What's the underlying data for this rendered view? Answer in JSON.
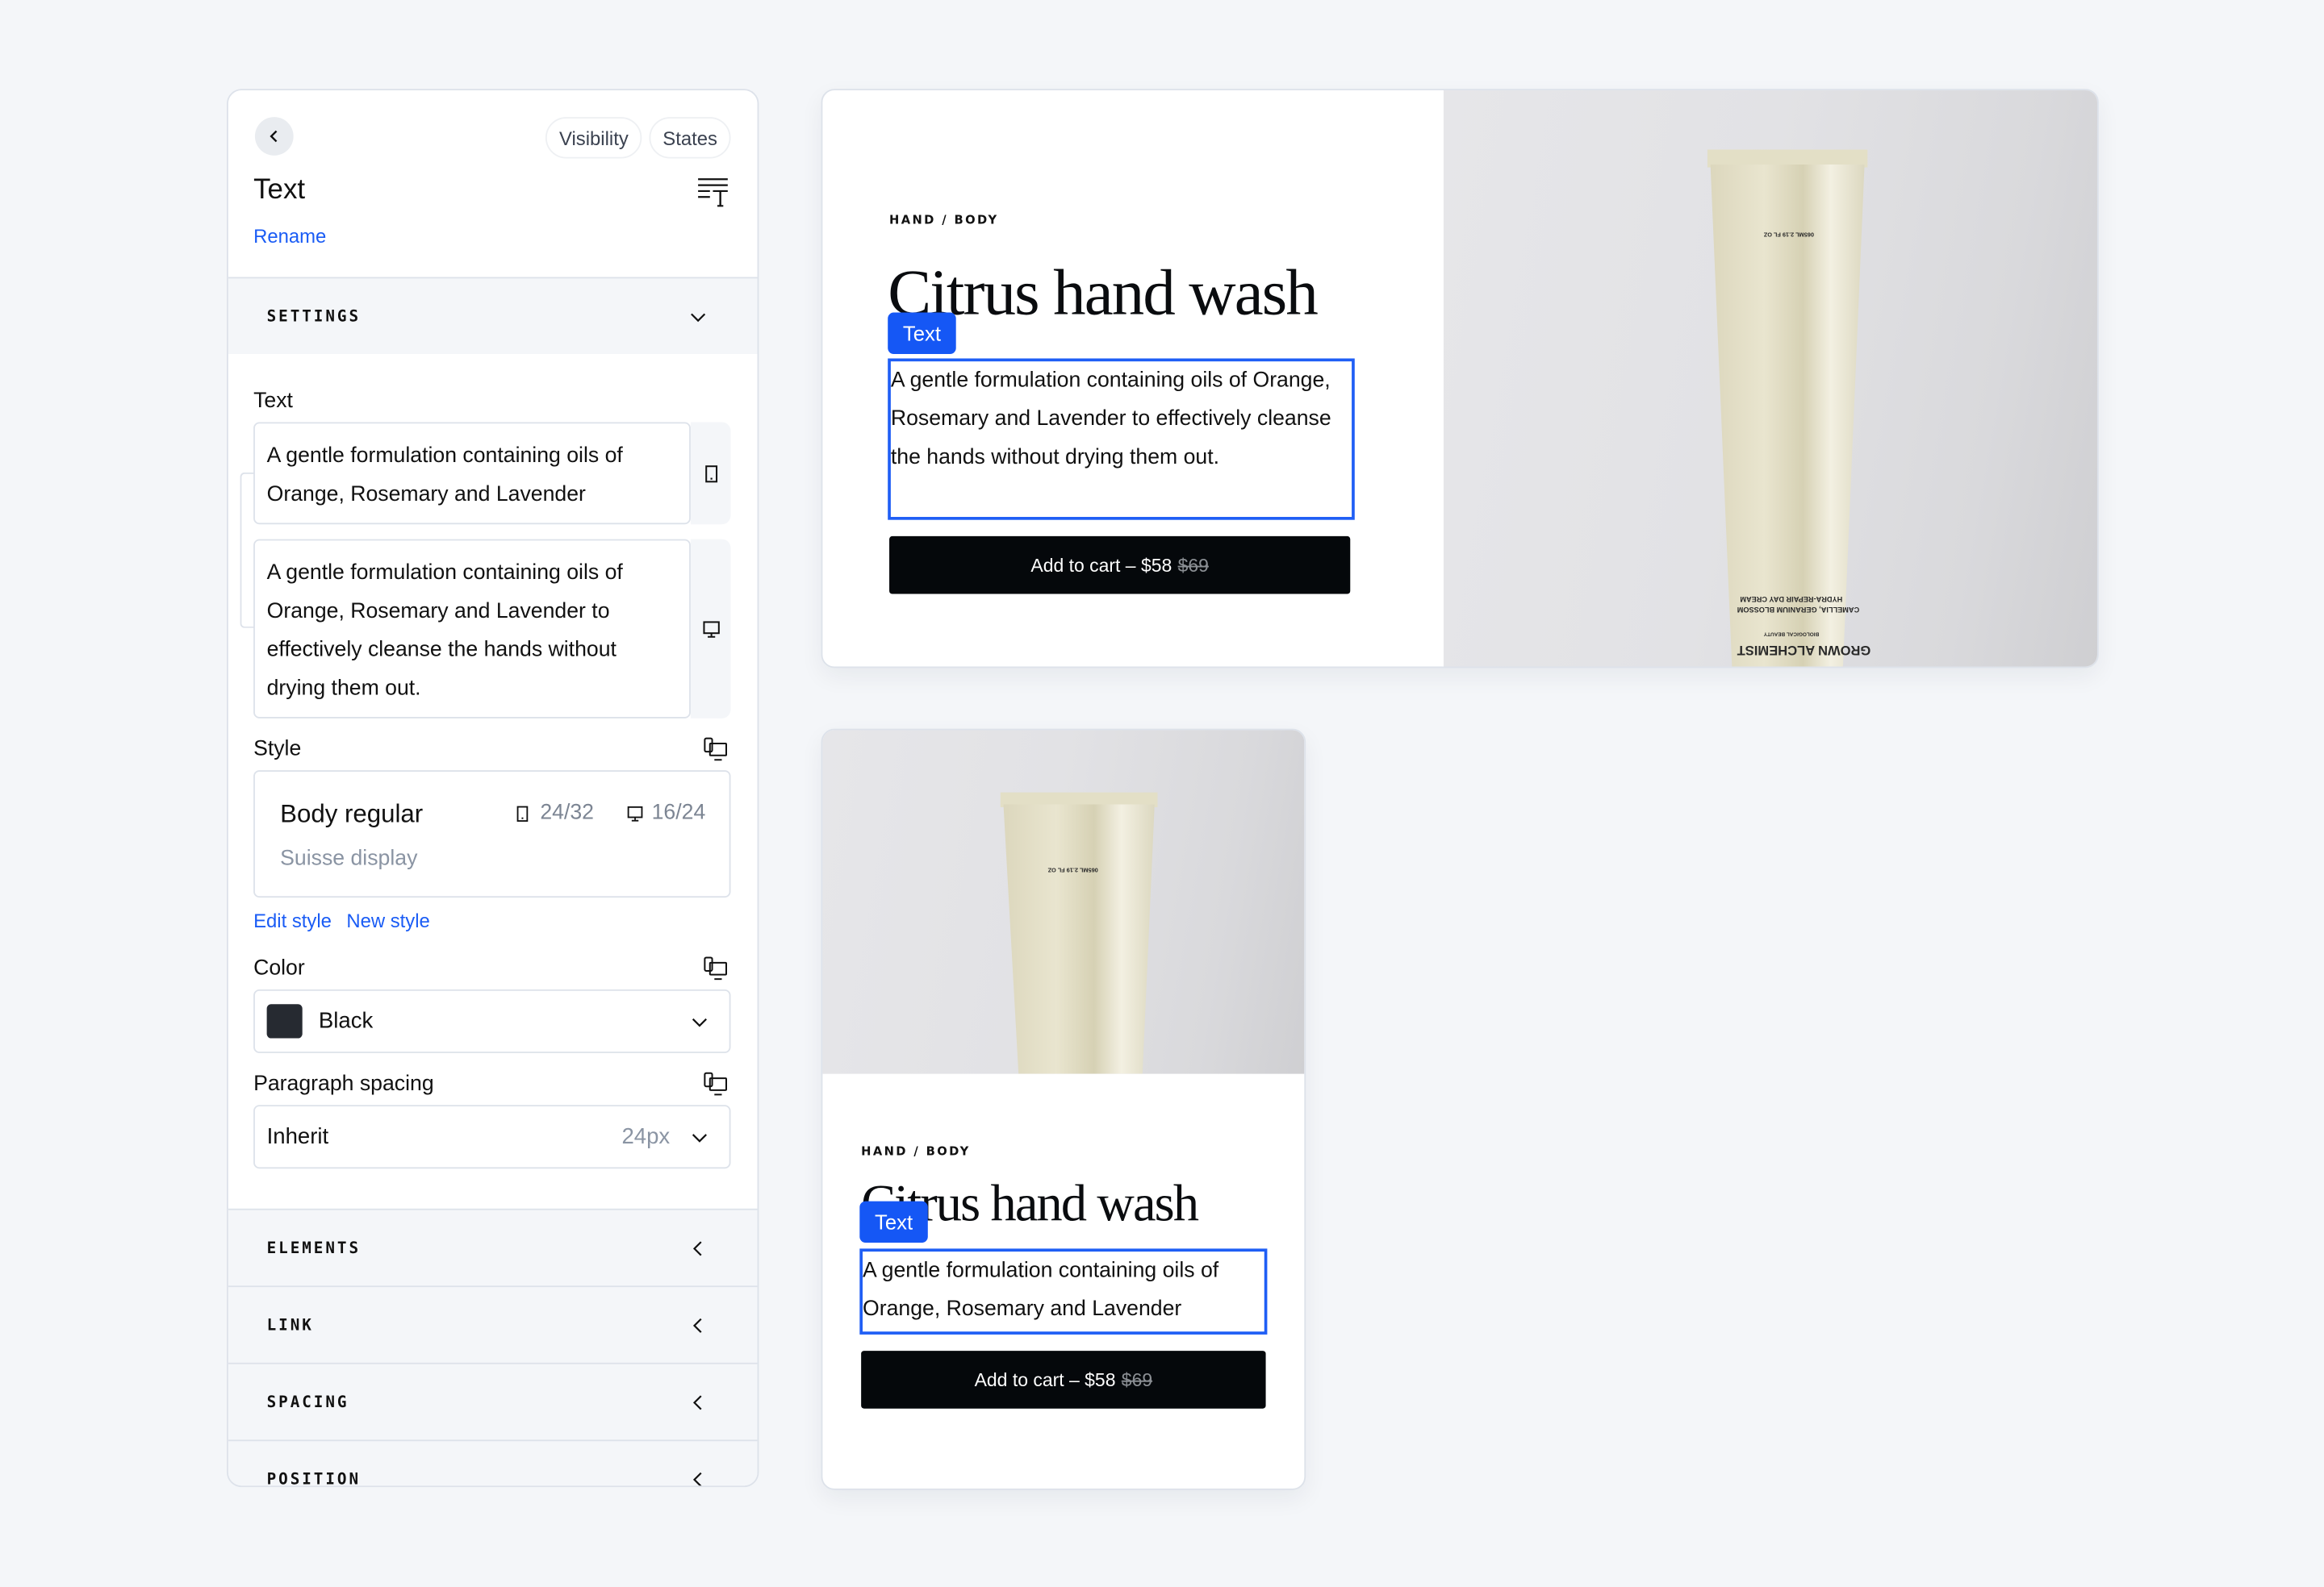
{
  "panel": {
    "back_label": "Back",
    "pills": {
      "visibility": "Visibility",
      "states": "States"
    },
    "title": "Text",
    "rename": "Rename",
    "sections": {
      "settings": "SETTINGS",
      "elements": "ELEMENTS",
      "link": "LINK",
      "spacing": "SPACING",
      "position": "POSITION"
    },
    "text_field": {
      "label": "Text",
      "mobile_value": "A gentle formulation containing oils of Orange, Rosemary and Lavender",
      "desktop_value": "A gentle formulation containing oils of Orange, Rosemary and Lavender to effectively cleanse the hands without drying them out."
    },
    "style": {
      "label": "Style",
      "name": "Body regular",
      "font": "Suisse display",
      "mobile_size": "24/32",
      "desktop_size": "16/24",
      "edit_link": "Edit style",
      "new_link": "New style"
    },
    "color": {
      "label": "Color",
      "value": "Black",
      "swatch": "#262a31"
    },
    "paragraph_spacing": {
      "label": "Paragraph spacing",
      "value": "Inherit",
      "unit_value": "24px"
    }
  },
  "previews": {
    "desktop": {
      "eyebrow": "HAND / BODY",
      "headline": "Citrus hand wash",
      "selection_tag": "Text",
      "body": "A gentle formulation containing oils of Orange, Rosemary and Lavender to effectively cleanse the hands without drying them out.",
      "cart_label": "Add to cart – $58",
      "old_price": "$69"
    },
    "mobile": {
      "eyebrow": "HAND / BODY",
      "headline": "Citrus hand wash",
      "selection_tag": "Text",
      "body": "A gentle formulation containing oils of Orange, Rosemary and Lavender",
      "cart_label": "Add to cart – $58",
      "old_price": "$69"
    },
    "product_label": {
      "volume": "065ML 2.19 FL OZ",
      "brand": "GROWN ALCHEMIST",
      "tagline": "BIOLOGICAL BEAUTY",
      "product": "HYDRA-REPAIR DAY CREAM",
      "ingredients": "CAMELLIA, GERANIUM BLOSSOM"
    }
  },
  "colors": {
    "accent": "#1557f5",
    "link": "#1a5cf5",
    "background": "#f4f6f9",
    "button": "#05080b"
  }
}
